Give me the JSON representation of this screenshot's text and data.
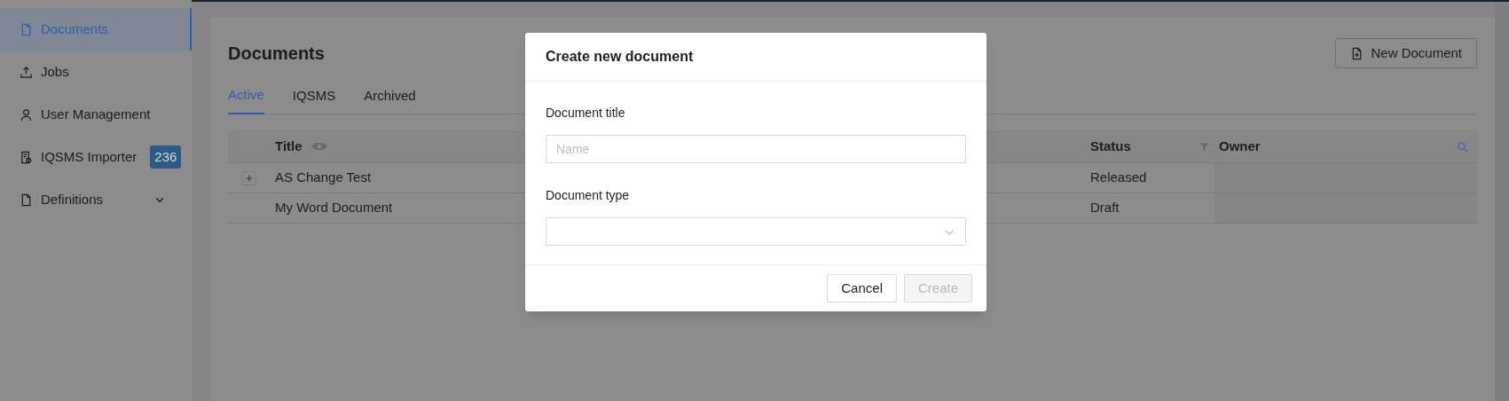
{
  "sidebar": {
    "items": [
      {
        "label": "Documents",
        "selected": true
      },
      {
        "label": "Jobs",
        "selected": false
      },
      {
        "label": "User Management",
        "selected": false
      },
      {
        "label": "IQSMS Importer",
        "selected": false,
        "badge": "236"
      },
      {
        "label": "Definitions",
        "selected": false,
        "expanded": false
      }
    ]
  },
  "page": {
    "title": "Documents",
    "new_button": "New Document",
    "tabs": [
      {
        "label": "Active",
        "selected": true
      },
      {
        "label": "IQSMS",
        "selected": false
      },
      {
        "label": "Archived",
        "selected": false
      }
    ],
    "table": {
      "columns": [
        {
          "label": "Title"
        },
        {
          "label": "Status"
        },
        {
          "label": "Owner"
        }
      ],
      "rows": [
        {
          "expandable": true,
          "title": "AS Change Test",
          "status": "Released"
        },
        {
          "expandable": false,
          "title": "My Word Document",
          "status": "Draft"
        }
      ]
    }
  },
  "modal": {
    "title": "Create new document",
    "fields": [
      {
        "kind": "text",
        "label": "Document title",
        "placeholder": "Name"
      },
      {
        "kind": "select",
        "label": "Document type"
      }
    ],
    "buttons": [
      {
        "label": "Cancel",
        "disabled": false
      },
      {
        "label": "Create",
        "disabled": true
      }
    ]
  }
}
